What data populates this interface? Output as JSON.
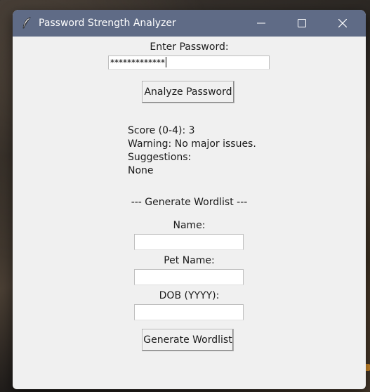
{
  "window": {
    "title": "Password Strength Analyzer",
    "title_bar_color": "#5f6b86",
    "background_color": "#f0f0f0",
    "app_icon": "feather-icon"
  },
  "controls": {
    "minimize_icon": "minimize-icon",
    "maximize_icon": "maximize-icon",
    "close_icon": "close-icon"
  },
  "password": {
    "label": "Enter Password:",
    "masked_value": "*************",
    "analyze_button": "Analyze Password"
  },
  "results": {
    "score": "Score (0-4): 3",
    "warning": "Warning: No major issues.",
    "suggestions_label": "Suggestions:",
    "suggestions_value": "None"
  },
  "wordlist": {
    "section_title": "--- Generate Wordlist ---",
    "name_label": "Name:",
    "name_value": "",
    "pet_label": "Pet Name:",
    "pet_value": "",
    "dob_label": "DOB (YYYY):",
    "dob_value": "",
    "generate_button": "Generate Wordlist"
  }
}
